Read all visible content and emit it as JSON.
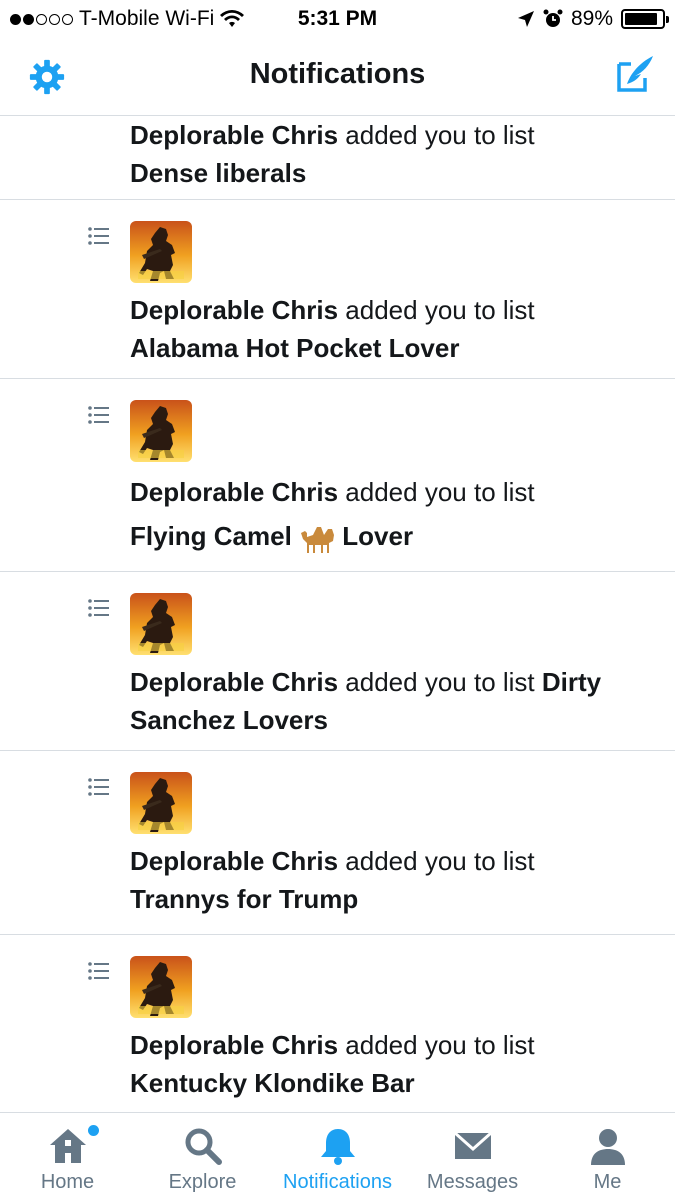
{
  "status_bar": {
    "carrier": "T-Mobile Wi-Fi",
    "time": "5:31 PM",
    "battery": "89%",
    "battery_level": 0.89
  },
  "nav": {
    "title": "Notifications",
    "settings_icon": "gear-icon",
    "compose_icon": "compose-icon"
  },
  "notifications": [
    {
      "user": "Deplorable Chris",
      "action": "added you to list",
      "list": "Dense liberals"
    },
    {
      "user": "Deplorable Chris",
      "action": "added you to list",
      "list": "Alabama Hot Pocket Lover"
    },
    {
      "user": "Deplorable Chris",
      "action": "added you to list",
      "list_before": "Flying Camel",
      "list_after": "Lover"
    },
    {
      "user": "Deplorable Chris",
      "action": "added you to list",
      "list": "Dirty Sanchez Lovers"
    },
    {
      "user": "Deplorable Chris",
      "action": "added you to list",
      "list": "Trannys for Trump"
    },
    {
      "user": "Deplorable Chris",
      "action": "added you to list",
      "list": "Kentucky Klondike Bar"
    }
  ],
  "tabs": [
    {
      "label": "Home",
      "icon": "home-icon"
    },
    {
      "label": "Explore",
      "icon": "search-icon"
    },
    {
      "label": "Notifications",
      "icon": "bell-icon"
    },
    {
      "label": "Messages",
      "icon": "envelope-icon"
    },
    {
      "label": "Me",
      "icon": "person-icon"
    }
  ],
  "colors": {
    "accent": "#1da1f2",
    "tab_inactive": "#657786",
    "divider": "#d8dde2"
  }
}
